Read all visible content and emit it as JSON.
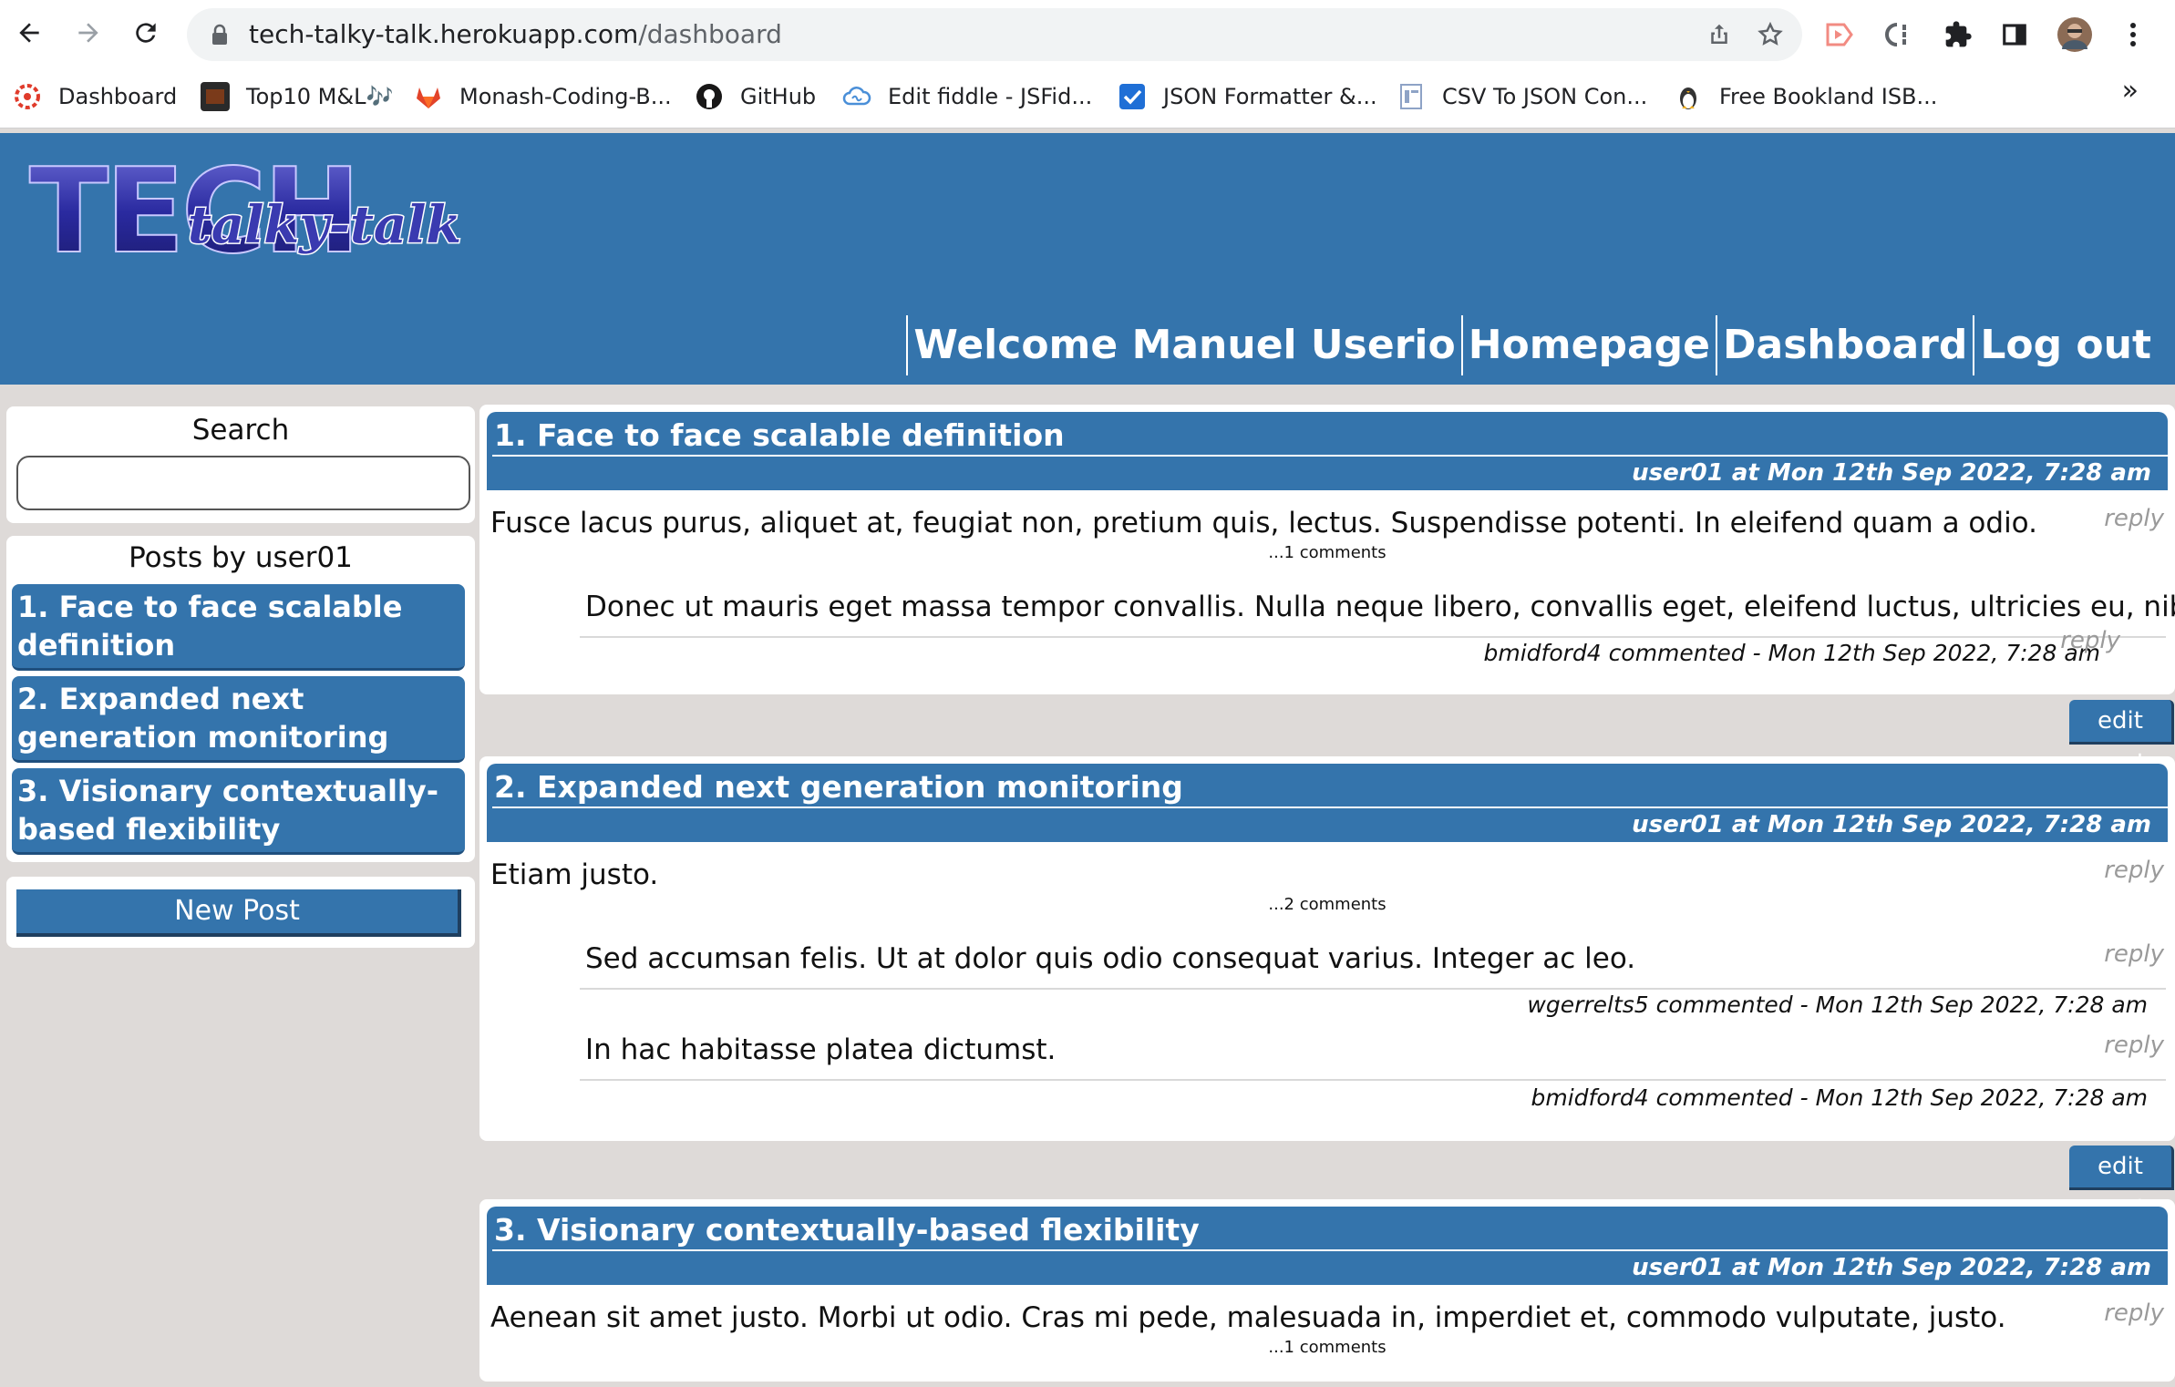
{
  "browser": {
    "url_host": "tech-talky-talk.herokuapp.com",
    "url_path": "/dashboard",
    "bookmarks": [
      {
        "label": "Dashboard",
        "icon": "canvas-icon",
        "color": "#e03b2b"
      },
      {
        "label": "Top10 M&L🎶",
        "icon": "top10-icon",
        "color": "#2a2a2a"
      },
      {
        "label": "Monash-Coding-B...",
        "icon": "gitlab-icon",
        "color": "#e2432a"
      },
      {
        "label": "GitHub",
        "icon": "github-icon",
        "color": "#181717"
      },
      {
        "label": "Edit fiddle - JSFid...",
        "icon": "cloud-icon",
        "color": "#4a8fd8"
      },
      {
        "label": "JSON Formatter &...",
        "icon": "checkbox-icon",
        "color": "#1f6fd6"
      },
      {
        "label": "CSV To JSON Con...",
        "icon": "document-icon",
        "color": "#8ea3c6"
      },
      {
        "label": "Free Bookland ISB...",
        "icon": "linux-penguin-icon",
        "color": "#333333"
      }
    ],
    "more": "»"
  },
  "site": {
    "logo_main": "TECH",
    "logo_sub": "talky-talk",
    "nav": [
      "Welcome Manuel Userio",
      "Homepage",
      "Dashboard",
      "Log out"
    ]
  },
  "sidebar": {
    "search_title": "Search",
    "search_value": "",
    "posts_title": "Posts by user01",
    "post_links": [
      "1. Face to face scalable definition",
      "2. Expanded next generation monitoring",
      "3. Visionary contextually-based flexibility"
    ],
    "new_post": "New Post"
  },
  "posts": [
    {
      "title": "1. Face to face scalable definition",
      "meta": "user01 at Mon 12th Sep 2022, 7:28 am",
      "body": "Fusce lacus purus, aliquet at, feugiat non, pretium quis, lectus. Suspendisse potenti. In eleifend quam a odio.",
      "reply": "reply",
      "comment_count": "...1 comments",
      "comments": [
        {
          "text": "Donec ut mauris eget massa tempor convallis. Nulla neque libero, convallis eget, eleifend luctus, ultricies eu, nibh.",
          "meta": "bmidford4 commented - Mon 12th Sep 2022, 7:28 am",
          "reply": "reply"
        }
      ],
      "edit": "edit post"
    },
    {
      "title": "2. Expanded next generation monitoring",
      "meta": "user01 at Mon 12th Sep 2022, 7:28 am",
      "body": "Etiam justo.",
      "reply": "reply",
      "comment_count": "...2 comments",
      "comments": [
        {
          "text": "Sed accumsan felis. Ut at dolor quis odio consequat varius. Integer ac leo.",
          "meta": "wgerrelts5 commented - Mon 12th Sep 2022, 7:28 am",
          "reply": "reply"
        },
        {
          "text": "In hac habitasse platea dictumst.",
          "meta": "bmidford4 commented - Mon 12th Sep 2022, 7:28 am",
          "reply": "reply"
        }
      ],
      "edit": "edit post"
    },
    {
      "title": "3. Visionary contextually-based flexibility",
      "meta": "user01 at Mon 12th Sep 2022, 7:28 am",
      "body": "Aenean sit amet justo. Morbi ut odio. Cras mi pede, malesuada in, imperdiet et, commodo vulputate, justo.",
      "reply": "reply",
      "comment_count": "...1 comments"
    }
  ],
  "colors": {
    "header": "#3474ac",
    "page_bg": "#dedad8"
  }
}
